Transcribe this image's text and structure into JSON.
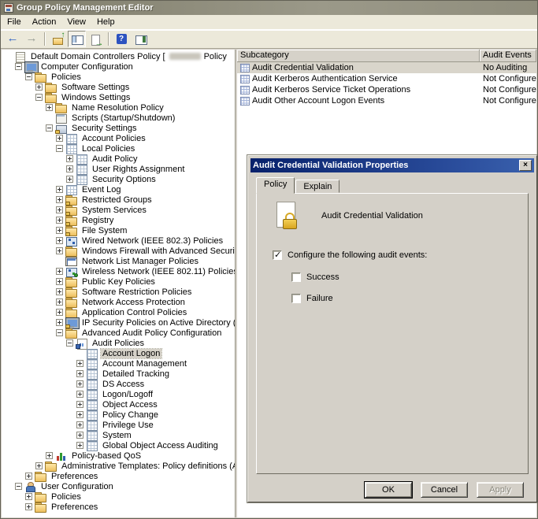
{
  "window": {
    "title": "Group Policy Management Editor"
  },
  "menu": {
    "items": [
      "File",
      "Action",
      "View",
      "Help"
    ]
  },
  "toolbar": {
    "buttons": [
      {
        "name": "back"
      },
      {
        "name": "forward"
      },
      {
        "name": "separator"
      },
      {
        "name": "up"
      },
      {
        "name": "show-console-tree",
        "pressed": true
      },
      {
        "name": "export-list"
      },
      {
        "name": "separator"
      },
      {
        "name": "help"
      },
      {
        "name": "show-action-pane"
      }
    ]
  },
  "tree": {
    "items": [
      {
        "label": "Default Domain Controllers Policy [",
        "depth": 0,
        "exp": "none",
        "icon": "gpo",
        "redact_w": 40,
        "suffix": "Policy"
      },
      {
        "label": "Computer Configuration",
        "depth": 1,
        "exp": "minus",
        "icon": "computer"
      },
      {
        "label": "Policies",
        "depth": 2,
        "exp": "minus",
        "icon": "folder"
      },
      {
        "label": "Software Settings",
        "depth": 3,
        "exp": "plus",
        "icon": "folder"
      },
      {
        "label": "Windows Settings",
        "depth": 3,
        "exp": "minus",
        "icon": "folder"
      },
      {
        "label": "Name Resolution Policy",
        "depth": 4,
        "exp": "plus",
        "icon": "folder"
      },
      {
        "label": "Scripts (Startup/Shutdown)",
        "depth": 4,
        "exp": "none",
        "icon": "scripts"
      },
      {
        "label": "Security Settings",
        "depth": 4,
        "exp": "minus",
        "icon": "security"
      },
      {
        "label": "Account Policies",
        "depth": 5,
        "exp": "plus",
        "icon": "table"
      },
      {
        "label": "Local Policies",
        "depth": 5,
        "exp": "minus",
        "icon": "table"
      },
      {
        "label": "Audit Policy",
        "depth": 6,
        "exp": "plus",
        "icon": "table"
      },
      {
        "label": "User Rights Assignment",
        "depth": 6,
        "exp": "plus",
        "icon": "table"
      },
      {
        "label": "Security Options",
        "depth": 6,
        "exp": "plus",
        "icon": "table"
      },
      {
        "label": "Event Log",
        "depth": 5,
        "exp": "plus",
        "icon": "table"
      },
      {
        "label": "Restricted Groups",
        "depth": 5,
        "exp": "plus",
        "icon": "folder-lock"
      },
      {
        "label": "System Services",
        "depth": 5,
        "exp": "plus",
        "icon": "folder-lock"
      },
      {
        "label": "Registry",
        "depth": 5,
        "exp": "plus",
        "icon": "folder-lock"
      },
      {
        "label": "File System",
        "depth": 5,
        "exp": "plus",
        "icon": "folder-lock"
      },
      {
        "label": "Wired Network (IEEE 802.3) Policies",
        "depth": 5,
        "exp": "plus",
        "icon": "network"
      },
      {
        "label": "Windows Firewall with Advanced Security",
        "depth": 5,
        "exp": "plus",
        "icon": "folder"
      },
      {
        "label": "Network List Manager Policies",
        "depth": 5,
        "exp": "none",
        "icon": "window"
      },
      {
        "label": "Wireless Network (IEEE 802.11) Policies",
        "depth": 5,
        "exp": "plus",
        "icon": "wireless"
      },
      {
        "label": "Public Key Policies",
        "depth": 5,
        "exp": "plus",
        "icon": "folder"
      },
      {
        "label": "Software Restriction Policies",
        "depth": 5,
        "exp": "plus",
        "icon": "folder"
      },
      {
        "label": "Network Access Protection",
        "depth": 5,
        "exp": "plus",
        "icon": "folder"
      },
      {
        "label": "Application Control Policies",
        "depth": 5,
        "exp": "plus",
        "icon": "folder"
      },
      {
        "label": "IP Security Policies on Active Directory (",
        "depth": 5,
        "exp": "plus",
        "icon": "ipsec",
        "redact_w": 14
      },
      {
        "label": "Advanced Audit Policy Configuration",
        "depth": 5,
        "exp": "minus",
        "icon": "folder"
      },
      {
        "label": "Audit Policies",
        "depth": 6,
        "exp": "minus",
        "icon": "audit"
      },
      {
        "label": "Account Logon",
        "depth": 7,
        "exp": "none",
        "icon": "table",
        "selected": true
      },
      {
        "label": "Account Management",
        "depth": 7,
        "exp": "plus",
        "icon": "table"
      },
      {
        "label": "Detailed Tracking",
        "depth": 7,
        "exp": "plus",
        "icon": "table"
      },
      {
        "label": "DS Access",
        "depth": 7,
        "exp": "plus",
        "icon": "table"
      },
      {
        "label": "Logon/Logoff",
        "depth": 7,
        "exp": "plus",
        "icon": "table"
      },
      {
        "label": "Object Access",
        "depth": 7,
        "exp": "plus",
        "icon": "table"
      },
      {
        "label": "Policy Change",
        "depth": 7,
        "exp": "plus",
        "icon": "table"
      },
      {
        "label": "Privilege Use",
        "depth": 7,
        "exp": "plus",
        "icon": "table"
      },
      {
        "label": "System",
        "depth": 7,
        "exp": "plus",
        "icon": "table"
      },
      {
        "label": "Global Object Access Auditing",
        "depth": 7,
        "exp": "plus",
        "icon": "table"
      },
      {
        "label": "Policy-based QoS",
        "depth": 4,
        "exp": "plus",
        "icon": "qos"
      },
      {
        "label": "Administrative Templates: Policy definitions (ADMX files)",
        "depth": 3,
        "exp": "plus",
        "icon": "folder"
      },
      {
        "label": "Preferences",
        "depth": 2,
        "exp": "plus",
        "icon": "folder"
      },
      {
        "label": "User Configuration",
        "depth": 1,
        "exp": "minus",
        "icon": "user"
      },
      {
        "label": "Policies",
        "depth": 2,
        "exp": "plus",
        "icon": "folder"
      },
      {
        "label": "Preferences",
        "depth": 2,
        "exp": "plus",
        "icon": "folder"
      }
    ]
  },
  "list": {
    "columns": [
      "Subcategory",
      "Audit Events"
    ],
    "rows": [
      {
        "subcategory": "Audit Credential Validation",
        "audit_events": "No Auditing",
        "selected": true
      },
      {
        "subcategory": "Audit Kerberos Authentication Service",
        "audit_events": "Not Configured",
        "selected": false
      },
      {
        "subcategory": "Audit Kerberos Service Ticket Operations",
        "audit_events": "Not Configured",
        "selected": false
      },
      {
        "subcategory": "Audit Other Account Logon Events",
        "audit_events": "Not Configured",
        "selected": false
      }
    ]
  },
  "dialog": {
    "title": "Audit Credential Validation Properties",
    "close_glyph": "×",
    "tabs": [
      {
        "label": "Policy",
        "active": true
      },
      {
        "label": "Explain",
        "active": false
      }
    ],
    "policy_name": "Audit Credential Validation",
    "configure_checkbox": {
      "label": "Configure the following audit events:",
      "checked": true
    },
    "options": [
      {
        "label": "Success",
        "checked": false
      },
      {
        "label": "Failure",
        "checked": false
      }
    ],
    "buttons": [
      {
        "label": "OK",
        "default": true,
        "enabled": true
      },
      {
        "label": "Cancel",
        "default": false,
        "enabled": true
      },
      {
        "label": "Apply",
        "default": false,
        "enabled": false
      }
    ]
  },
  "colors": {
    "window_titlebar": "#8f8d7c",
    "dialog_titlebar": "#0a246a",
    "face": "#d4d0c8",
    "menu_bg": "#ece9da",
    "selection_inactive": "#d5d1c8",
    "list_bg": "#ffffff"
  }
}
